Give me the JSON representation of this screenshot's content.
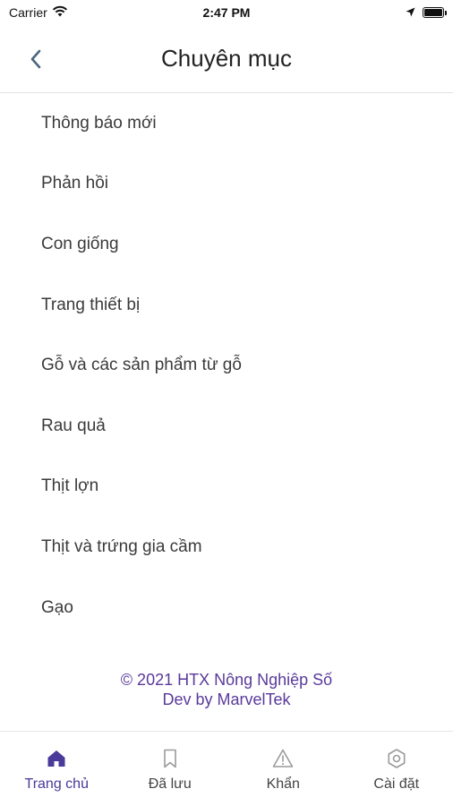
{
  "status_bar": {
    "carrier": "Carrier",
    "time": "2:47 PM"
  },
  "header": {
    "title": "Chuyên mục"
  },
  "categories": [
    {
      "label": "Thông báo mới"
    },
    {
      "label": "Phản hồi"
    },
    {
      "label": "Con giống"
    },
    {
      "label": "Trang thiết bị"
    },
    {
      "label": "Gỗ và các sản phẩm từ gỗ"
    },
    {
      "label": "Rau quả"
    },
    {
      "label": "Thịt lợn"
    },
    {
      "label": "Thịt và trứng gia cầm"
    },
    {
      "label": "Gạo"
    }
  ],
  "footer": {
    "copyright": "© 2021 HTX Nông Nghiệp Số",
    "dev": "Dev by MarvelTek"
  },
  "tabs": [
    {
      "label": "Trang chủ",
      "icon": "home-icon",
      "active": true
    },
    {
      "label": "Đã lưu",
      "icon": "bookmark-icon",
      "active": false
    },
    {
      "label": "Khẩn",
      "icon": "warning-icon",
      "active": false
    },
    {
      "label": "Cài đặt",
      "icon": "settings-icon",
      "active": false
    }
  ],
  "colors": {
    "accent": "#4a3a9a",
    "footer_text": "#5a3a9a",
    "inactive_icon": "#9a9a9a"
  }
}
